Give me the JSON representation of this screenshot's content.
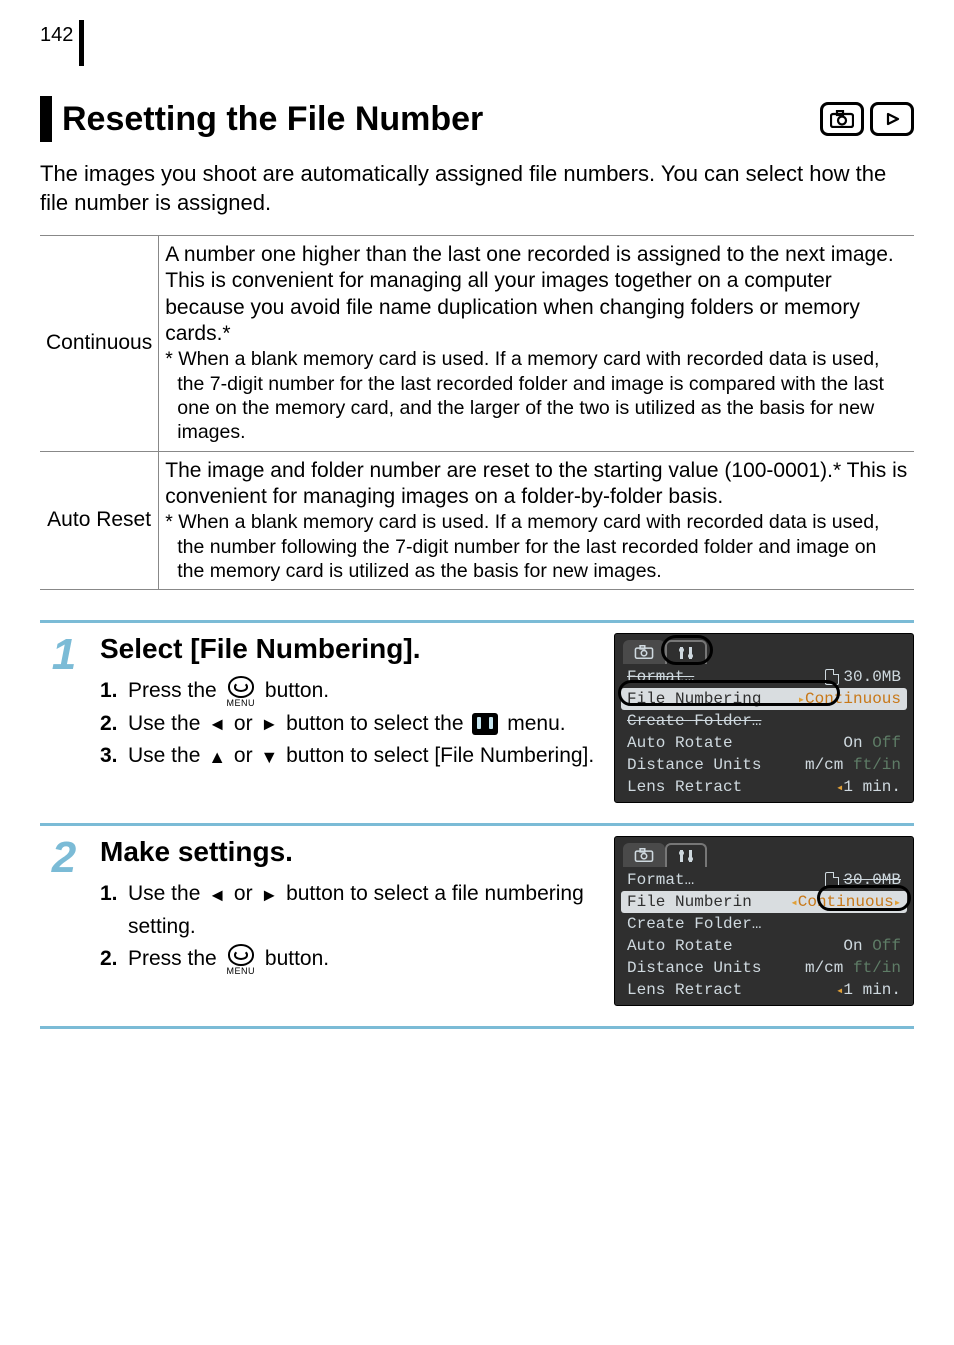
{
  "page_number": "142",
  "title": "Resetting the File Number",
  "intro": "The images you shoot are automatically assigned file numbers. You can select how the file number is assigned.",
  "table": {
    "rows": [
      {
        "head": "Continuous",
        "body": "A number one higher than the last one recorded is assigned to the next image. This is convenient for managing all your images together on a computer because you avoid file name duplication when changing folders or memory cards.*",
        "foot": "* When a blank memory card is used. If a memory card with recorded data is used, the 7-digit number for the last recorded folder and image is compared with the last one on the memory card, and the larger of the two is utilized as the basis for new images."
      },
      {
        "head": "Auto Reset",
        "body": "The image and folder number are reset to the starting value (100-0001).* This is convenient for managing images on a folder-by-folder basis.",
        "foot": "* When a blank memory card is used. If a memory card with recorded data is used, the number following the 7-digit number for the last recorded folder and image on the memory card is utilized as the basis for new images."
      }
    ]
  },
  "steps": [
    {
      "num": "1",
      "title": "Select [File Numbering].",
      "items": [
        {
          "n": "1.",
          "pre": "Press the ",
          "post": " button.",
          "icon": "menu"
        },
        {
          "n": "2.",
          "pre": "Use the ",
          "mid": " or ",
          "post": " button to select the ",
          "tail": " menu.",
          "icon": "lr-arrows-setup"
        },
        {
          "n": "3.",
          "pre": "Use the ",
          "mid": " or ",
          "post": " button to select [File Numbering].",
          "icon": "ud-arrows"
        }
      ]
    },
    {
      "num": "2",
      "title": "Make settings.",
      "items": [
        {
          "n": "1.",
          "pre": "Use the ",
          "mid": " or ",
          "post": " button to select a file numbering setting.",
          "icon": "lr-arrows"
        },
        {
          "n": "2.",
          "pre": "Press the ",
          "post": " button.",
          "icon": "menu"
        }
      ]
    }
  ],
  "lcd": {
    "format_label": "Format…",
    "format_size": "30.0MB",
    "file_numbering_label": "File Numbering",
    "file_numbering_label_trunc": "File Numberin",
    "file_numbering_value": "Continuous",
    "create_folder": "Create Folder…",
    "auto_rotate_label": "Auto Rotate",
    "auto_rotate_on": "On",
    "auto_rotate_off": "Off",
    "distance_label": "Distance Units",
    "distance_mcm": "m/cm",
    "distance_ftin": "ft/in",
    "lens_label": "Lens Retract",
    "lens_val": "1 min."
  },
  "icons": {
    "menu_label": "MENU"
  }
}
